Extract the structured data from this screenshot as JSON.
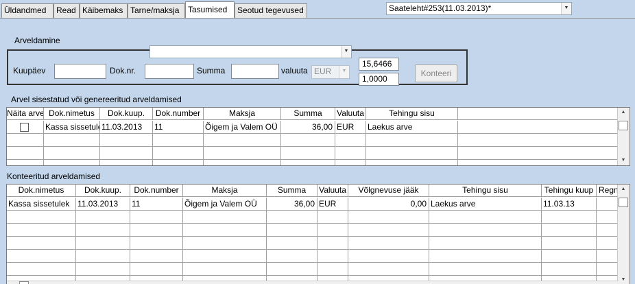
{
  "tabs": [
    "Üldandmed",
    "Read",
    "Käibemaks",
    "Tarne/maksja",
    "Tasumised",
    "Seotud tegevused"
  ],
  "active_tab": "Tasumised",
  "document_select": "Saateleht#253(11.03.2013)*",
  "arveldamine": {
    "title": "Arveldamine",
    "top_combo": "",
    "kuupaev_label": "Kuupäev",
    "kuupaev_value": "",
    "doknr_label": "Dok.nr.",
    "doknr_value": "",
    "summa_label": "Summa",
    "summa_value": "",
    "valuuta_label": "valuuta",
    "valuuta_value": "EUR",
    "rate_1": "15,6466",
    "rate_2": "1,0000",
    "konteeri_label": "Konteeri"
  },
  "grid1": {
    "title": "Arvel sisestatud või genereeritud arveldamised",
    "headers": [
      "Näita arve",
      "Dok.nimetus",
      "Dok.kuup.",
      "Dok.number",
      "Maksja",
      "Summa",
      "Valuuta",
      "Tehingu sisu"
    ],
    "rows": [
      {
        "checked": false,
        "dok_nimetus": "Kassa sissetulek",
        "dok_kuup": "11.03.2013",
        "dok_number": "11",
        "maksja": "Õigem ja Valem OÜ",
        "summa": "36,00",
        "valuuta": "EUR",
        "tehingu_sisu": "Laekus arve"
      }
    ]
  },
  "grid2": {
    "title": "Konteeritud arveldamised",
    "headers": [
      "Dok.nimetus",
      "Dok.kuup.",
      "Dok.number",
      "Maksja",
      "Summa",
      "Valuuta",
      "Võlgnevuse jääk",
      "Tehingu sisu",
      "Tehingu kuup",
      "Regn"
    ],
    "rows": [
      {
        "dok_nimetus": "Kassa sissetulek",
        "dok_kuup": "11.03.2013",
        "dok_number": "11",
        "maksja": "Õigem ja Valem OÜ",
        "summa": "36,00",
        "valuuta": "EUR",
        "volgnevus": "0,00",
        "tehingu_sisu": "Laekus arve",
        "tehingu_kuup": "11.03.13",
        "regn": ""
      }
    ]
  }
}
